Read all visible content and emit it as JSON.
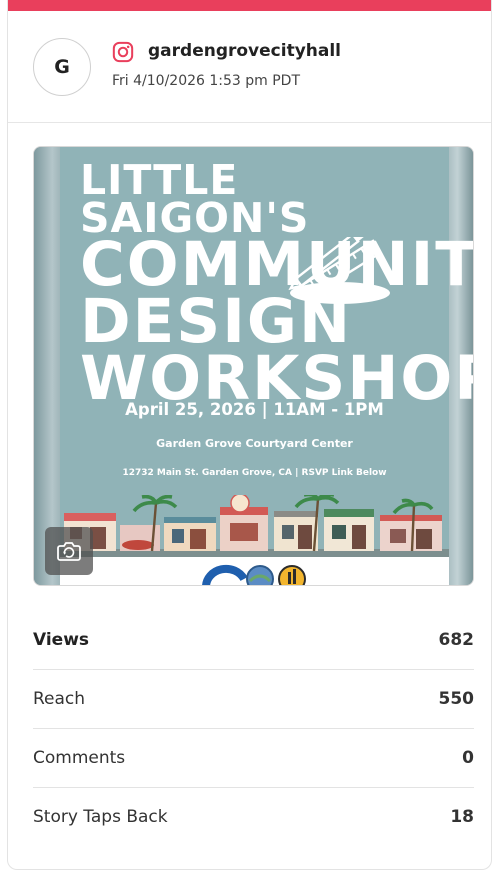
{
  "post": {
    "avatar_letter": "G",
    "platform_icon": "instagram-icon",
    "account": "gardengrovecityhall",
    "timestamp": "Fri 4/10/2026 1:53 pm PDT",
    "accent_color": "#e93f5c"
  },
  "poster": {
    "title_line1": "LITTLE SAIGON'S",
    "title_line2": "COMMUNITY",
    "title_line3": "DESIGN",
    "title_line4": "WORKSHOP",
    "date_time": "April 25, 2026 | 11AM - 1PM",
    "venue": "Garden Grove Courtyard Center",
    "address": "12732 Main St. Garden Grove, CA | RSVP Link Below"
  },
  "media_overlay_icon": "camera-icon",
  "stats": [
    {
      "label": "Views",
      "value": "682"
    },
    {
      "label": "Reach",
      "value": "550"
    },
    {
      "label": "Comments",
      "value": "0"
    },
    {
      "label": "Story Taps Back",
      "value": "18"
    }
  ]
}
